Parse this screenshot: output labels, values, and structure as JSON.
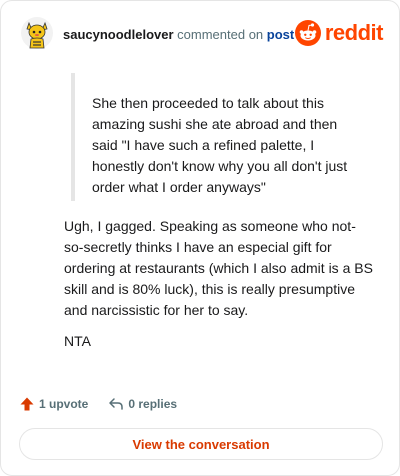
{
  "header": {
    "username": "saucynoodlelover",
    "action_text": " commented on ",
    "post_link": "post",
    "brand": "reddit"
  },
  "comment": {
    "quote": "She then proceeded to talk about this amazing sushi she ate abroad and then said \"I have such a refined palette, I honestly don't know why you all don't just order what I order anyways\"",
    "paragraph_1": "Ugh, I gagged. Speaking as someone who not-so-secretly thinks I have an especial gift for ordering at restaurants (which I also admit is a BS skill and is 80% luck), this is really presumptive and narcissistic for her to say.",
    "paragraph_2": "NTA"
  },
  "stats": {
    "upvotes": "1 upvote",
    "replies": "0 replies"
  },
  "cta": {
    "label": "View the conversation"
  },
  "colors": {
    "brand_orange": "#ff4500",
    "upvote_orange": "#d93a00",
    "link_blue": "#0a449b",
    "muted": "#576f76",
    "border": "#e5e5e5"
  },
  "icons": {
    "avatar": "snoo-avatar",
    "brand": "reddit-logo-icon",
    "upvote": "upvote-arrow-icon",
    "reply": "reply-arrow-icon"
  }
}
